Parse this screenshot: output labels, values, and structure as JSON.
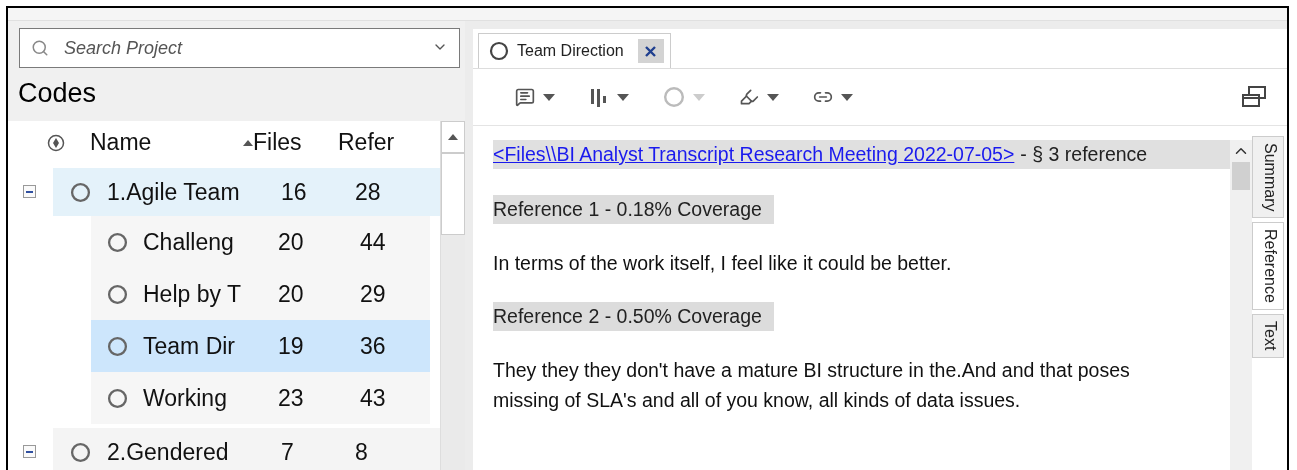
{
  "search": {
    "placeholder": "Search Project"
  },
  "codes_title": "Codes",
  "columns": [
    {
      "label": "Name",
      "sorted": true
    },
    {
      "label": "Files",
      "sorted": false
    },
    {
      "label": "Refer",
      "sorted": false
    }
  ],
  "codes": [
    {
      "name": "1.Agile Team",
      "files": "16",
      "refs": "28",
      "expanded": true,
      "highlighted": true,
      "selected": false,
      "children": [
        {
          "name": "Challeng",
          "files": "20",
          "refs": "44",
          "selected": false
        },
        {
          "name": "Help by T",
          "files": "20",
          "refs": "29",
          "selected": false
        },
        {
          "name": "Team Dir",
          "files": "19",
          "refs": "36",
          "selected": true
        },
        {
          "name": "Working",
          "files": "23",
          "refs": "43",
          "selected": false
        }
      ]
    },
    {
      "name": "2.Gendered",
      "files": "7",
      "refs": "8",
      "expanded": true,
      "highlighted": false,
      "selected": false
    }
  ],
  "tab": {
    "label": "Team Direction",
    "selected": true
  },
  "toolbar": [
    {
      "kind": "memo",
      "disabled": false
    },
    {
      "kind": "stripes",
      "disabled": false
    },
    {
      "kind": "circle",
      "disabled": true
    },
    {
      "kind": "highlight",
      "disabled": false
    },
    {
      "kind": "link",
      "disabled": false
    }
  ],
  "content": [
    {
      "kind": "header",
      "link": "<Files\\\\BI Analyst  Transcript  Research Meeting  2022-07-05>",
      "text": "- § 3 reference"
    },
    {
      "kind": "heading",
      "text": "Reference 1 - 0.18% Coverage"
    },
    {
      "kind": "text",
      "lines": [
        "In terms of the work itself, I feel like it could be better."
      ]
    },
    {
      "kind": "heading",
      "text": "Reference 2 - 0.50% Coverage"
    },
    {
      "kind": "text",
      "lines": [
        "They they they don't have a mature BI structure in the.And and that poses",
        "missing of SLA's and all of you know, all kinds of data issues."
      ]
    }
  ],
  "side_tabs": [
    {
      "label": "Summary",
      "selected": false
    },
    {
      "label": "Reference",
      "selected": true
    },
    {
      "label": "Text",
      "selected": false
    }
  ]
}
